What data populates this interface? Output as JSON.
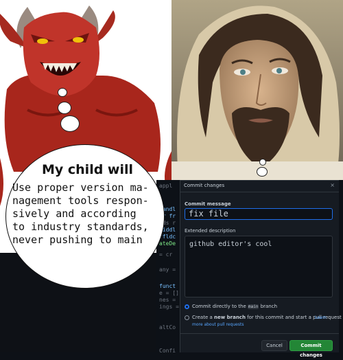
{
  "bubble": {
    "title": "My child will",
    "body": "Use proper version ma-\nnagement tools respon-\nsively and according\nto industry standards,\nnever pushing to main"
  },
  "dialog": {
    "title": "Commit changes",
    "commit_message_label": "Commit message",
    "commit_message_value": "fix file",
    "extended_description_label": "Extended description",
    "extended_description_value": "github editor's cool",
    "option_direct_prefix": "Commit directly to the ",
    "option_direct_branch": "main",
    "option_direct_suffix": " branch",
    "option_new_prefix": "Create a ",
    "option_new_bold": "new branch",
    "option_new_suffix": " for this commit and start a pull request",
    "learn_more_1": "Learn",
    "learn_more_2": "more about pull requests",
    "cancel_label": "Cancel",
    "commit_label": "Commit changes",
    "close_label": "×"
  },
  "colors": {
    "devil_red": "#b3241d",
    "dialog_bg": "#161b22",
    "accent_blue": "#1f6feb",
    "commit_green": "#238636"
  }
}
